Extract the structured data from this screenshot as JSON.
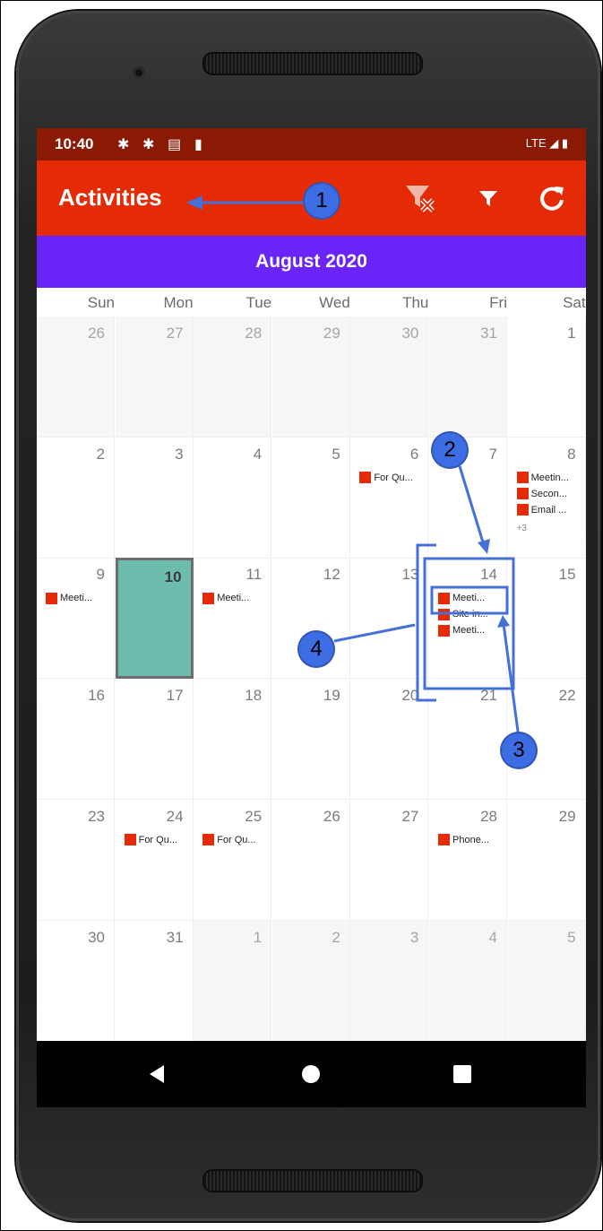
{
  "status_bar": {
    "time": "10:40",
    "network": "LTE"
  },
  "app_bar": {
    "title": "Activities"
  },
  "calendar": {
    "month_title": "August 2020",
    "weekdays": [
      "Sun",
      "Mon",
      "Tue",
      "Wed",
      "Thu",
      "Fri",
      "Sat"
    ],
    "weeks": [
      [
        {
          "d": "26",
          "out": true
        },
        {
          "d": "27",
          "out": true
        },
        {
          "d": "28",
          "out": true
        },
        {
          "d": "29",
          "out": true
        },
        {
          "d": "30",
          "out": true
        },
        {
          "d": "31",
          "out": true
        },
        {
          "d": "1"
        }
      ],
      [
        {
          "d": "2"
        },
        {
          "d": "3"
        },
        {
          "d": "4"
        },
        {
          "d": "5"
        },
        {
          "d": "6",
          "events": [
            "For Qu..."
          ]
        },
        {
          "d": "7"
        },
        {
          "d": "8",
          "events": [
            "Meetin...",
            "Secon...",
            "Email ..."
          ],
          "more": "+3"
        }
      ],
      [
        {
          "d": "9",
          "events": [
            "Meeti..."
          ]
        },
        {
          "d": "10",
          "today": true
        },
        {
          "d": "11",
          "events": [
            "Meeti..."
          ]
        },
        {
          "d": "12"
        },
        {
          "d": "13"
        },
        {
          "d": "14",
          "events": [
            "Meeti...",
            "Site in...",
            "Meeti..."
          ]
        },
        {
          "d": "15"
        }
      ],
      [
        {
          "d": "16"
        },
        {
          "d": "17"
        },
        {
          "d": "18"
        },
        {
          "d": "19"
        },
        {
          "d": "20"
        },
        {
          "d": "21"
        },
        {
          "d": "22"
        }
      ],
      [
        {
          "d": "23"
        },
        {
          "d": "24",
          "events": [
            "For Qu..."
          ]
        },
        {
          "d": "25",
          "events": [
            "For Qu..."
          ]
        },
        {
          "d": "26"
        },
        {
          "d": "27"
        },
        {
          "d": "28",
          "events": [
            "Phone..."
          ]
        },
        {
          "d": "29"
        }
      ],
      [
        {
          "d": "30"
        },
        {
          "d": "31"
        },
        {
          "d": "1",
          "out": true
        },
        {
          "d": "2",
          "out": true
        },
        {
          "d": "3",
          "out": true
        },
        {
          "d": "4",
          "out": true
        },
        {
          "d": "5",
          "out": true
        }
      ]
    ]
  },
  "callouts": [
    "1",
    "2",
    "3",
    "4"
  ],
  "colors": {
    "status": "#8b1a05",
    "appbar": "#e52a06",
    "month": "#6a24f7",
    "today": "#6dbdae",
    "event": "#e52a06",
    "callout": "#3d6de2"
  },
  "icons": [
    "settings-icon",
    "sd-card-icon",
    "signal-icon",
    "battery-icon",
    "clear-filter-icon",
    "filter-icon",
    "refresh-icon",
    "back-icon",
    "home-icon",
    "recents-icon"
  ]
}
